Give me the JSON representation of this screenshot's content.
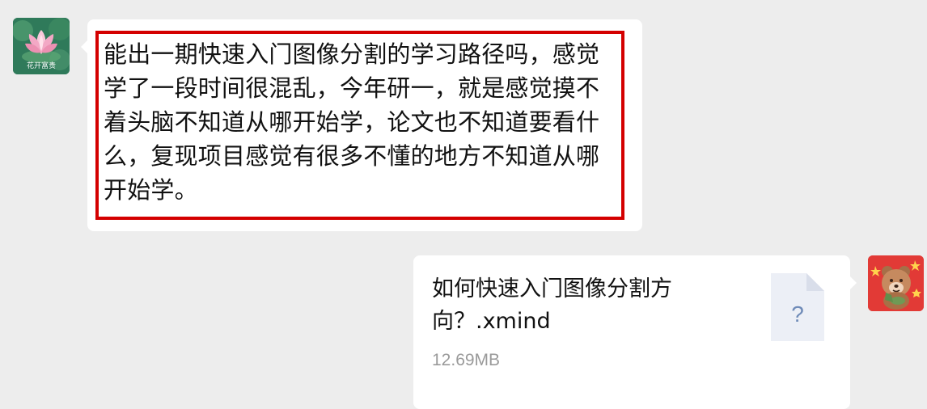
{
  "conversation": {
    "incoming": {
      "sender_avatar": {
        "icon": "lotus-icon",
        "caption": "花开富贵"
      },
      "message": "能出一期快速入门图像分割的学习路径吗，感觉学了一段时间很混乱，今年研一，就是感觉摸不着头脑不知道从哪开始学，论文也不知道要看什么，复现项目感觉有很多不懂的地方不知道从哪开始学。",
      "highlight_color": "#d40000"
    },
    "outgoing": {
      "avatar": {
        "icon": "cartoon-bear-avatar-icon"
      },
      "file": {
        "name": "如何快速入门图像分割方向？.xmind",
        "size": "12.69MB",
        "icon": "unknown-file-icon",
        "icon_glyph": "?"
      }
    }
  },
  "colors": {
    "chat_background": "#ededed",
    "bubble_background": "#ffffff",
    "primary_text": "#111111",
    "secondary_text": "#9a9a9a",
    "file_icon_fill": "#eceff6",
    "file_icon_glyph": "#6f8bb8"
  }
}
